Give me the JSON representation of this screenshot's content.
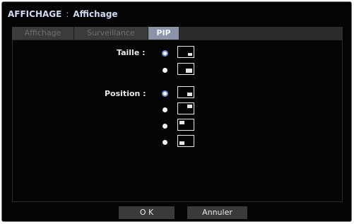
{
  "title": {
    "section": "AFFICHAGE",
    "separator": ":",
    "page": "Affichage"
  },
  "tabs": [
    {
      "label": "Affichage",
      "active": false
    },
    {
      "label": "Surveillance",
      "active": false
    },
    {
      "label": "PIP",
      "active": true
    }
  ],
  "size": {
    "label": "Taille :",
    "options": [
      {
        "icon": "pip-small-bottom-right-icon",
        "selected": true
      },
      {
        "icon": "pip-large-bottom-right-icon",
        "selected": false
      }
    ]
  },
  "position": {
    "label": "Position :",
    "options": [
      {
        "icon": "pip-bottom-right-icon",
        "selected": true
      },
      {
        "icon": "pip-top-right-icon",
        "selected": false
      },
      {
        "icon": "pip-top-left-icon",
        "selected": false
      },
      {
        "icon": "pip-bottom-left-icon",
        "selected": false
      }
    ]
  },
  "buttons": {
    "ok": "O K",
    "cancel": "Annuler"
  },
  "colors": {
    "background": "#040404",
    "title_text": "#cfd9f2",
    "active_tab": "#8a93a8",
    "radio_ring": "#6d8fd6"
  }
}
